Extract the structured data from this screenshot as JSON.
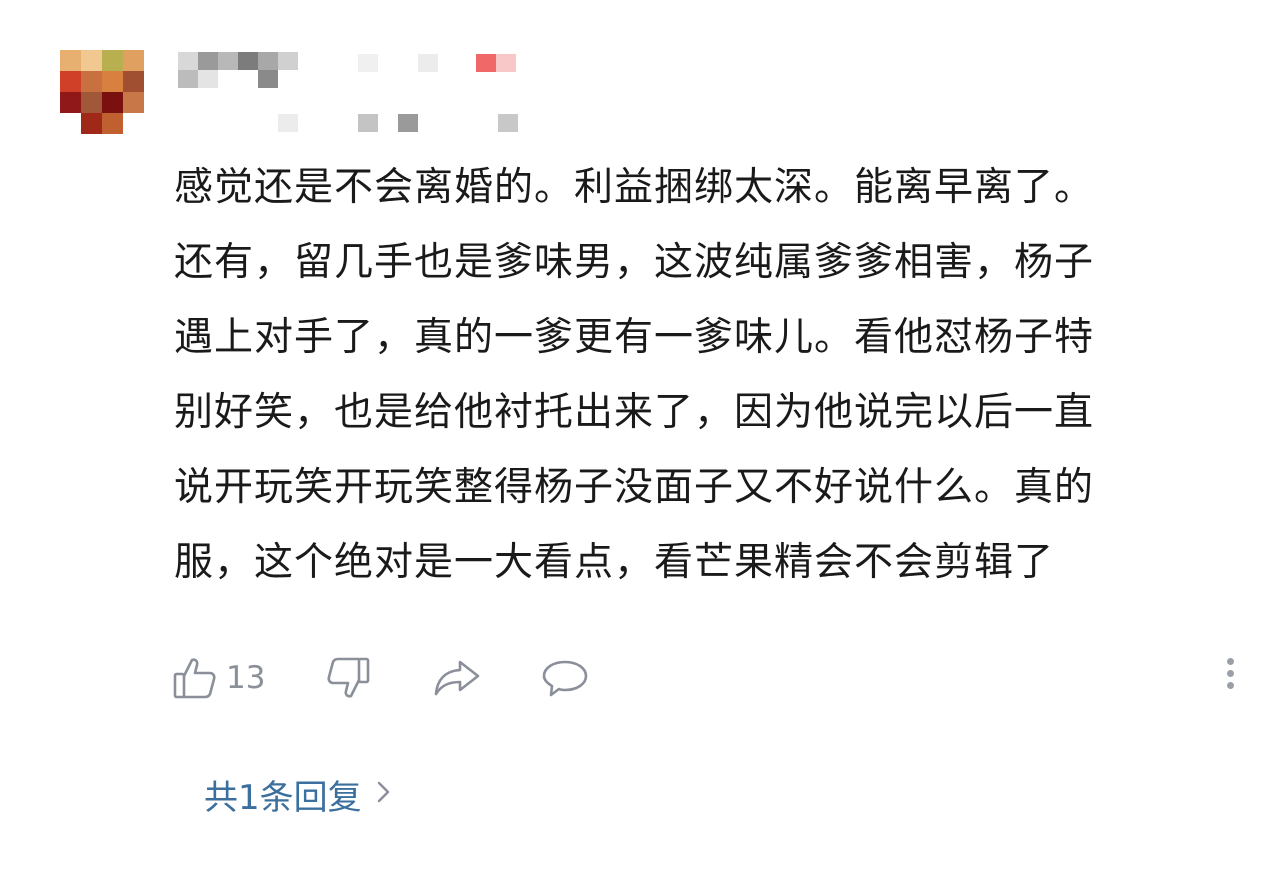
{
  "comment": {
    "lines": [
      "感觉还是不会离婚的。利益捆绑太深。能离早离了。",
      "还有，留几手也是爹味男，这波纯属爹爹相害，杨子",
      "遇上对手了，真的一爹更有一爹味儿。看他怼杨子特",
      "别好笑，也是给他衬托出来了，因为他说完以后一直",
      "说开玩笑开玩笑整得杨子没面子又不好说什么。真的",
      "服，这个绝对是一大看点，看芒果精会不会剪辑了"
    ]
  },
  "actions": {
    "like_count": "13",
    "like_icon": "thumbs-up-icon",
    "dislike_icon": "thumbs-down-icon",
    "share_icon": "share-icon",
    "reply_icon": "comment-bubble-icon",
    "more_icon": "more-vertical-icon"
  },
  "replies": {
    "label": "共1条回复"
  },
  "colors": {
    "text": "#1a1a1a",
    "icon_gray": "#8a8f99",
    "reply_link": "#3b6f9e"
  }
}
